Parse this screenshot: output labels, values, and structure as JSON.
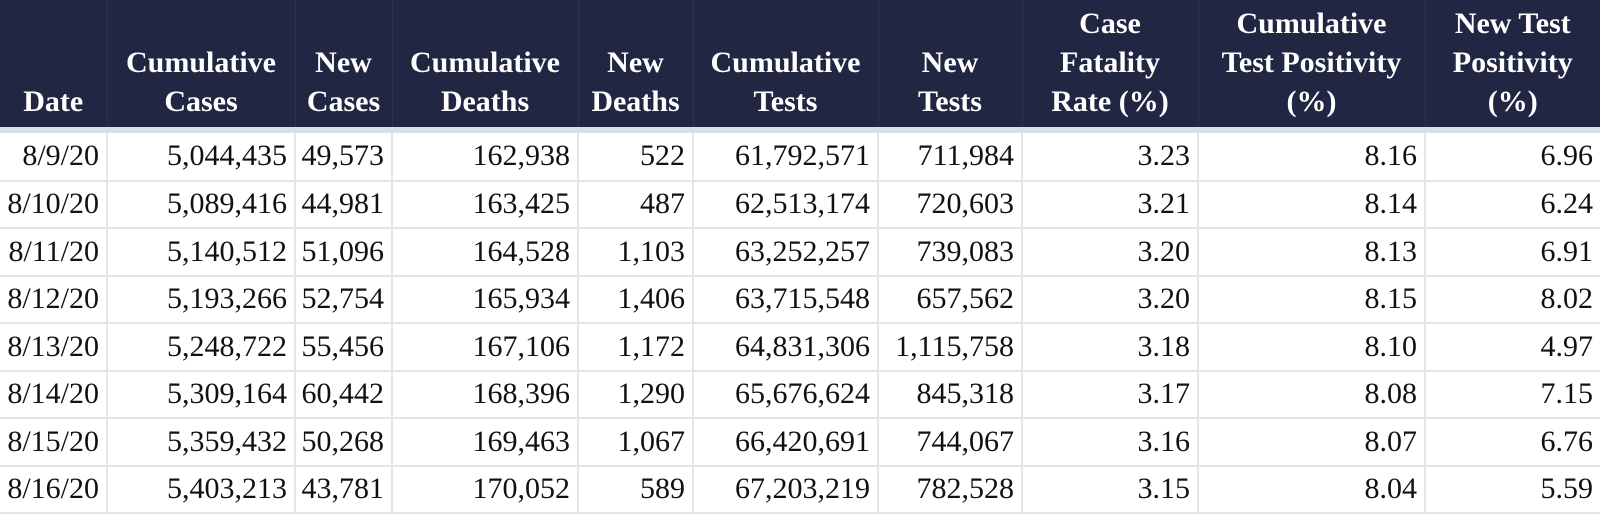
{
  "table": {
    "headers": [
      "Date",
      "Cumulative\nCases",
      "New\nCases",
      "Cumulative\nDeaths",
      "New\nDeaths",
      "Cumulative\nTests",
      "New\nTests",
      "Case\nFatality\nRate (%)",
      "Cumulative\nTest Positivity\n(%)",
      "New Test\nPositivity\n(%)"
    ],
    "rows": [
      [
        "8/9/20",
        "5,044,435",
        "49,573",
        "162,938",
        "522",
        "61,792,571",
        "711,984",
        "3.23",
        "8.16",
        "6.96"
      ],
      [
        "8/10/20",
        "5,089,416",
        "44,981",
        "163,425",
        "487",
        "62,513,174",
        "720,603",
        "3.21",
        "8.14",
        "6.24"
      ],
      [
        "8/11/20",
        "5,140,512",
        "51,096",
        "164,528",
        "1,103",
        "63,252,257",
        "739,083",
        "3.20",
        "8.13",
        "6.91"
      ],
      [
        "8/12/20",
        "5,193,266",
        "52,754",
        "165,934",
        "1,406",
        "63,715,548",
        "657,562",
        "3.20",
        "8.15",
        "8.02"
      ],
      [
        "8/13/20",
        "5,248,722",
        "55,456",
        "167,106",
        "1,172",
        "64,831,306",
        "1,115,758",
        "3.18",
        "8.10",
        "4.97"
      ],
      [
        "8/14/20",
        "5,309,164",
        "60,442",
        "168,396",
        "1,290",
        "65,676,624",
        "845,318",
        "3.17",
        "8.08",
        "7.15"
      ],
      [
        "8/15/20",
        "5,359,432",
        "50,268",
        "169,463",
        "1,067",
        "66,420,691",
        "744,067",
        "3.16",
        "8.07",
        "6.76"
      ],
      [
        "8/16/20",
        "5,403,213",
        "43,781",
        "170,052",
        "589",
        "67,203,219",
        "782,528",
        "3.15",
        "8.04",
        "5.59"
      ]
    ]
  },
  "colors": {
    "header_bg": "#212742",
    "header_text": "#ffffff",
    "separator": "#d6deeb",
    "grid": "#e4e4e4",
    "cell_text": "#111111"
  }
}
